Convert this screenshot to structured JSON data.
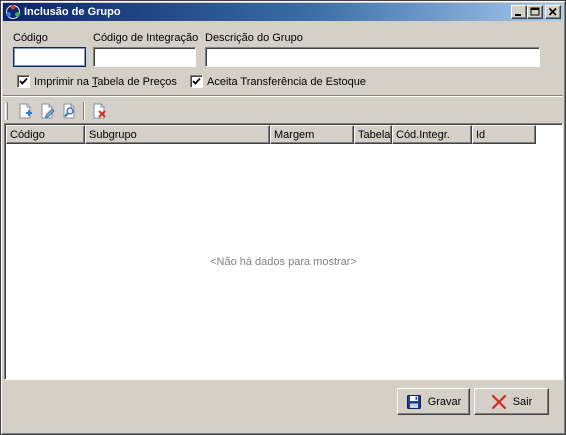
{
  "window": {
    "title": "Inclusão de Grupo"
  },
  "form": {
    "codigo_label": "Código",
    "codigo_value": "",
    "codigo_integracao_label": "Código de Integração",
    "codigo_integracao_value": "",
    "descricao_label": "Descrição do Grupo",
    "descricao_value": "",
    "imprimir_label_pre": "Imprimir na ",
    "imprimir_label_accel": "T",
    "imprimir_label_post": "abela de Preços",
    "imprimir_checked": true,
    "aceita_label": "Aceita Transferência de Estoque",
    "aceita_checked": true
  },
  "toolbar": {
    "icons": [
      "add-row-icon",
      "edit-row-icon",
      "search-row-icon",
      "delete-row-icon"
    ]
  },
  "grid": {
    "columns": [
      "Código",
      "Subgrupo",
      "Margem",
      "Tabela",
      "Cód.Integr.",
      "Id"
    ],
    "rows": [],
    "empty_message": "<Não há dados para mostrar>"
  },
  "buttons": {
    "save_label": "Gravar",
    "exit_label": "Sair"
  },
  "colors": {
    "title_gradient_start": "#0a246a",
    "title_gradient_end": "#a6caf0",
    "face": "#d4d0c8",
    "exit_icon": "#d62a1f",
    "save_icon": "#1f3f8f"
  }
}
